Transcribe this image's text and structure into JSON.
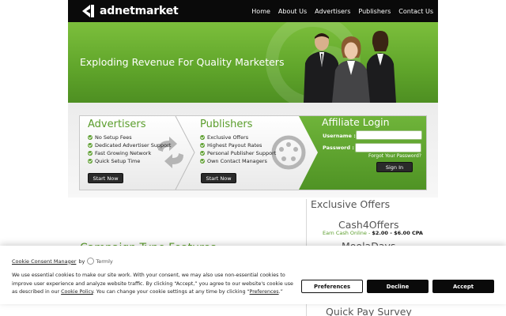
{
  "header": {
    "logo_text": "adnetmarket",
    "nav": [
      "Home",
      "About Us",
      "Advertisers",
      "Publishers",
      "Contact Us"
    ]
  },
  "banner": {
    "headline": "Exploding Revenue For Quality Marketers"
  },
  "advertisers": {
    "title": "Advertisers",
    "items": [
      "No Setup Fees",
      "Dedicated Advertiser Support",
      "Fast Growing Network",
      "Quick Setup Time"
    ],
    "button": "Start Now"
  },
  "publishers": {
    "title": "Publishers",
    "items": [
      "Exclusive Offers",
      "Highest Payout Rates",
      "Personal Publisher Support",
      "Own Contact Managers"
    ],
    "button": "Start Now"
  },
  "login": {
    "title": "Affiliate Login",
    "username_label": "Username :",
    "password_label": "Password :",
    "username_value": "",
    "password_value": "",
    "forgot": "Forgot Your Password?",
    "signin": "Sign In"
  },
  "offers": {
    "title": "Exclusive Offers",
    "items": [
      {
        "name": "Cash4Offers",
        "desc_prefix": "Earn Cash Online - ",
        "desc_value": "$2.00 - $6.00 CPA"
      },
      {
        "name": "MoolaDays"
      },
      {
        "name": "Quick Pay Survey"
      }
    ]
  },
  "main": {
    "partial_heading": "Campaign Type Features"
  },
  "cookie": {
    "title": "Cookie Consent Manager",
    "by": "by",
    "brand": "Termly",
    "text_before_policy": "We use essential cookies to make our site work. With your consent, we may also use non-essential cookies to improve user experience and analyze website traffic. By clicking “Accept,” you agree to our website's cookie use as described in our ",
    "policy_link": "Cookie Policy",
    "text_middle": ". You can change your cookie settings at any time by clicking “",
    "prefs_link": "Preferences",
    "text_end": ".”",
    "buttons": {
      "preferences": "Preferences",
      "decline": "Decline",
      "accept": "Accept"
    }
  },
  "colors": {
    "brand_green": "#5a9d2b",
    "header_black": "#0a0a0a"
  }
}
